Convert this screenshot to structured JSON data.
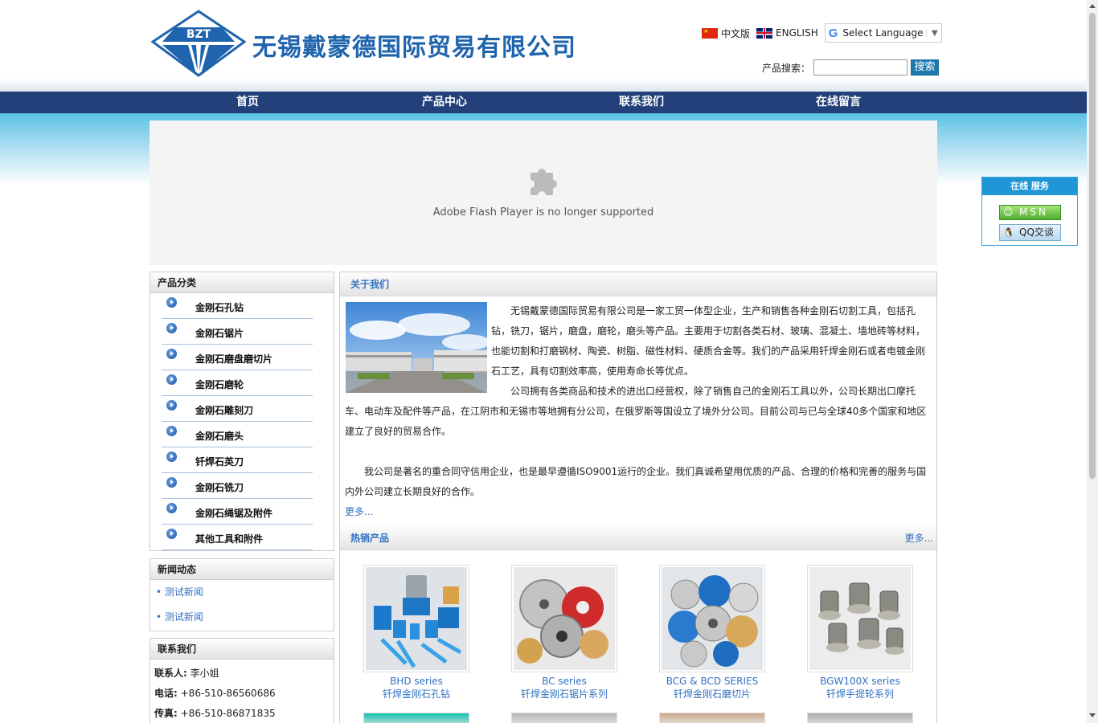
{
  "header": {
    "company_name": "无锡戴蒙德国际贸易有限公司",
    "logo_text": "BZT",
    "lang_cn": "中文版",
    "lang_en": "ENGLISH",
    "translate_label": "Select Language",
    "search_label": "产品搜索：",
    "search_value": "",
    "search_button": "搜索"
  },
  "nav": [
    "首页",
    "产品中心",
    "联系我们",
    "在线留言"
  ],
  "flash": {
    "message": "Adobe Flash Player is no longer supported"
  },
  "categories": {
    "title": "产品分类",
    "items": [
      "金刚石孔钻",
      "金刚石锯片",
      "金刚石磨盘磨切片",
      "金刚石磨轮",
      "金刚石雕刻刀",
      "金刚石磨头",
      "钎焊石英刀",
      "金刚石铣刀",
      "金刚石绳锯及附件",
      "其他工具和附件"
    ]
  },
  "news": {
    "title": "新闻动态",
    "items": [
      "• 测试新闻",
      "• 测试新闻"
    ]
  },
  "contact": {
    "title": "联系我们",
    "person_label": "联系人:",
    "person": " 李小姐",
    "phone_label": "电话:",
    "phone": " +86-510-86560686",
    "fax_label": "传真:",
    "fax": " +86-510-86871835"
  },
  "about": {
    "title": "关于我们",
    "p1": "无锡戴蒙德国际贸易有限公司是一家工贸一体型企业，生产和销售各种金刚石切割工具，包括孔钻，铣刀，锯片，磨盘，磨轮，磨头等产品。主要用于切割各类石材、玻璃、混凝土、墙地砖等材料，也能切割和打磨钢材、陶瓷、树脂、磁性材料、硬质合金等。我们的产品采用钎焊金刚石或者电镀金刚石工艺，具有切割效率高，使用寿命长等优点。",
    "p2": "公司拥有各类商品和技术的进出口经营权，除了销售自己的金刚石工具以外，公司长期出口摩托车、电动车及配件等产品，在江阴市和无锡市等地拥有分公司，在俄罗斯等国设立了境外分公司。目前公司与已与全球40多个国家和地区建立了良好的贸易合作。",
    "p3": "我公司是著名的重合同守信用企业，也是最早遵循ISO9001运行的企业。我们真诚希望用优质的产品、合理的价格和完善的服务与国内外公司建立长期良好的合作。",
    "more": "更多..."
  },
  "hot": {
    "title": "热销产品",
    "more": "更多...",
    "products": [
      {
        "en": "BHD series",
        "cn": "钎焊金刚石孔钻"
      },
      {
        "en": "BC series",
        "cn": "钎焊金刚石锯片系列"
      },
      {
        "en": "BCG & BCD SERIES",
        "cn": "钎焊金刚石磨切片"
      },
      {
        "en": "BGW100X series",
        "cn": "钎焊手提轮系列"
      }
    ]
  },
  "online": {
    "title": "在线 服务",
    "msn": "MSN",
    "qq": "QQ交谈"
  },
  "colors": {
    "nav_bg": "#23407b",
    "brand_blue": "#1f64ad",
    "link_blue": "#3372c2"
  }
}
